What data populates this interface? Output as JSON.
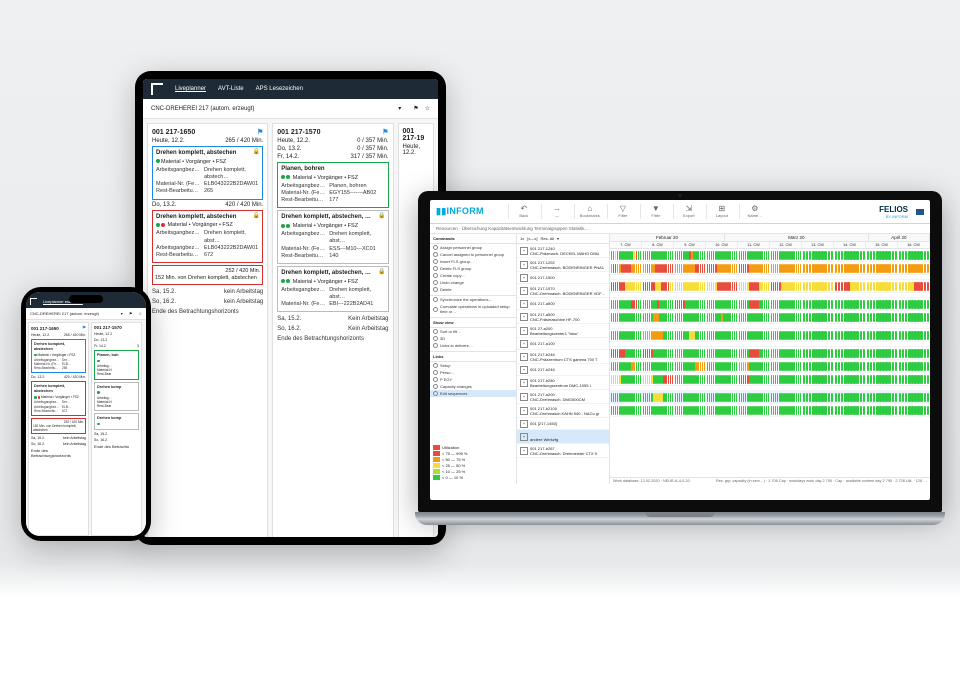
{
  "nav": {
    "liveplanner": "Liveplanner",
    "avt": "AVT-Liste",
    "aps": "APS Lesezeichen"
  },
  "selector": {
    "title": "CNC-DREHEREI 217 (autom. erzeugt)"
  },
  "col1": {
    "id": "001 217-1650",
    "day1": {
      "d": "Heute, 12.2.",
      "m": "265 / 420 Min."
    },
    "card1": {
      "title": "Drehen komplett, abstechen",
      "dots": "gyg",
      "tags": "Material  • Vorgänger  • FSZ",
      "r1k": "Arbeitsgangbez…",
      "r1v": "Drehen komplett, abstech…",
      "r2k": "Material-Nr. (Fe…",
      "r2v": "ELB043222B2DAW01",
      "r3k": "Rest-Bearbeitu…",
      "r3v": "265"
    },
    "day2": {
      "d": "Do, 13.2.",
      "m": "420 / 420 Min."
    },
    "card2": {
      "title": "Drehen komplett, abstechen",
      "dots": "grg",
      "tags": "Material  • Vorgänger  • FSZ",
      "r1k": "Arbeitsgangbez…",
      "r1v": "Drehen komplett, abst…",
      "r2k": "Arbeitsgangbez…",
      "r2v": "ELB043222B2DAW01",
      "r3k": "Rest-Bearbeitu…",
      "r3v": "672"
    },
    "band": "252 / 420 Min.",
    "bandnote": "152 Min. von Drehen komplett, abstechen",
    "s1": {
      "d": "Sa, 15.2.",
      "t": "kein Arbeitstag"
    },
    "s2": {
      "d": "So, 16.2.",
      "t": "kein Arbeitstag"
    },
    "end": "Ende des Betrachtungshorizonts"
  },
  "col2": {
    "id": "001 217-1570",
    "day1": {
      "d": "Heute, 12.2.",
      "m": "0 / 357 Min."
    },
    "day2": {
      "d": "Do, 13.2.",
      "m": "0 / 357 Min."
    },
    "day3": {
      "d": "Fr, 14.2.",
      "m": "317 / 357 Min."
    },
    "card1": {
      "title": "Planen, bohren",
      "dots": "ggg",
      "tags": "Material  • Vorgänger  • FSZ",
      "r1k": "Arbeitsgangbez…",
      "r1v": "Planen, bohren",
      "r2k": "Material-Nr. (Fe…",
      "r2v": "EGY155-------AB02",
      "r3k": "Rest-Bearbeitu…",
      "r3v": "177"
    },
    "card2": {
      "title": "Drehen komplett, abstechen, …",
      "dots": "ggg",
      "tags": "Material  • Vorgänger  • FSZ",
      "r1k": "Arbeitsgangbez…",
      "r1v": "Drehen komplett, abst…",
      "r2k": "Material-Nr. (Fe…",
      "r2v": "ESS---M10---XC01",
      "r3k": "Rest-Bearbeitu…",
      "r3v": "140"
    },
    "card3": {
      "title": "Drehen komplett, abstechen, …",
      "dots": "ggg",
      "tags": "Material  • Vorgänger  • FSZ",
      "r1k": "Arbeitsgangbez…",
      "r1v": "Drehen komplett, abst…",
      "r2k": "Material-Nr. (Fe…",
      "r2v": "EBI---222B2AD41",
      "r3k": "Rest-Bearbeitu…",
      "r3v": ""
    },
    "s1": {
      "d": "Sa, 15.2.",
      "t": "Kein Arbeitstag"
    },
    "s2": {
      "d": "So, 16.2.",
      "t": "Kein Arbeitstag"
    },
    "end": "Ende des Betrachtungshorizonts"
  },
  "col3": {
    "id": "001 217-19",
    "day1": {
      "d": "Heute, 12.2."
    }
  },
  "phone": {
    "nav": "Liveplanner  eszeichen",
    "selector": "CNC-DREHEREI 217 (autom. erzeugt)",
    "c1": {
      "id": "001 217-1650",
      "d1": "Heute, 12.2.",
      "m1": "265 / 420 Min.",
      "d2": "Do, 13.2.",
      "m2": "420 / 420 Min.",
      "band": "252 / 420 Min.",
      "bandnote": "152 Min. von Drehen komplett, abstechen",
      "s1": "Sa, 15.2.",
      "s1t": "kein Arbeitstag",
      "s2": "So, 16.2.",
      "s2t": "kein Arbeitstag",
      "end": "Ende des Betrachtungshorizonts"
    },
    "c2": {
      "id": "001 217-1570",
      "d1": "Heute, 12.2",
      "d3": "Fr, 14.2",
      "m3": "3",
      "pb": "Planen, boh",
      "dk": "Drehen komp",
      "s1": "Sa, 15.2.",
      "s2": "So, 16.2.",
      "end": "Ende des Betrachtu"
    }
  },
  "fl": {
    "brand1": "INFORM",
    "brand2": "FELIOS",
    "brand2sub": "BY INFORM",
    "toolbar": [
      {
        "ic": "↶",
        "lb": "Back"
      },
      {
        "ic": "→",
        "lb": "—"
      },
      {
        "ic": "⌂",
        "lb": "Bookmarks"
      },
      {
        "ic": "▽",
        "lb": "Filter"
      },
      {
        "ic": "▼",
        "lb": "Filter"
      },
      {
        "ic": "⇲",
        "lb": "Export"
      },
      {
        "ic": "⊞",
        "lb": "Layout"
      },
      {
        "ic": "⚙",
        "lb": "Name…"
      }
    ],
    "tabs": "Resourcen · Übersichung Kapazitätsentwicklung Terminalgruppen Statistik…",
    "rl_head": {
      "a": "1x",
      "b": "[x—x]",
      "c": "Res. All"
    },
    "cmd_h": "Commands",
    "cmds": [
      "Assign personnel group",
      "Cancel assigned to personnel group",
      "Insert FLS group…",
      "Delete FLS group",
      "Create copy…",
      "Undo change",
      "Delete"
    ],
    "cmd2": [
      "Synchronize the operations…",
      "Cumulate operations in uploaded setup time or…"
    ],
    "view_h": "Show view",
    "views": [
      "Sort or filt…",
      "3D",
      "Links to delivere…"
    ],
    "link_h": "Links",
    "links": [
      "Setup",
      "Perso…",
      "P EGY",
      "Capacity changes",
      "Edit sequences"
    ],
    "legend": [
      {
        "c": "r",
        "t": "Utilization"
      },
      {
        "c": "r",
        "t": "< 75 — 999 %"
      },
      {
        "c": "o",
        "t": "< 50 — 75 %"
      },
      {
        "c": "y",
        "t": "< 25 — 50 %"
      },
      {
        "c": "lg1",
        "t": "< 10 — 25 %"
      },
      {
        "c": "g",
        "t": "<  0 — 10 %"
      }
    ],
    "resources": [
      {
        "id": "001 217-1240",
        "n": "CNC-Präzmach. DECKEL MAHO DMU"
      },
      {
        "id": "001 217-1292",
        "n": "CNC-Drehmasch. BODENRINGER PNA1"
      },
      {
        "id": "001 217-1500",
        "n": ""
      },
      {
        "id": "001 217-1570",
        "n": "CNC-Drehmasch. BODENRINGER VDF 21"
      },
      {
        "id": "001 217-a500",
        "n": ""
      },
      {
        "id": "001 217-a500",
        "n": "CNC-Fräsmaschine HF-700"
      },
      {
        "id": "001 27-a200",
        "n": "Bearbeitungscenter1 \"blau\""
      },
      {
        "id": "001 217-a100",
        "n": ""
      },
      {
        "id": "001 217-b246",
        "n": "CNC-Präzzentrum CTS gamma 700 T"
      },
      {
        "id": "001 217-b246",
        "n": ""
      },
      {
        "id": "001 217-b280",
        "n": "Bearbeitungszentrum DMC-1055 I"
      },
      {
        "id": "001 217-a200",
        "n": "CNC-Drehmasch. DMG500CM"
      },
      {
        "id": "001 217-b2100",
        "n": "CNC-Drehmasch KAHN 540 - NACo gr"
      },
      {
        "id": "001 [217-1450]",
        "n": ""
      },
      {
        "id": "",
        "n": "andere Werkzfg"
      },
      {
        "id": "001 217-b267",
        "n": "CNC-Drehmasch. Drehmeister CTX 5"
      }
    ],
    "months": [
      {
        "n": "Februar 20",
        "w": 36
      },
      {
        "n": "März 20",
        "w": 45
      },
      {
        "n": "April 20",
        "w": 19
      }
    ],
    "weeks": [
      "7. CW",
      "8. CW",
      "9. CW",
      "10. CW",
      "11. CW",
      "12. CW",
      "13. CW",
      "14. CW",
      "15. CW",
      "16. CW"
    ],
    "rows": [
      "ggygg ggggg gyrgg|ggggg ggggg ggggg|ggggg ggrog ggggg|ggggg ggggg ggggg|ggggg ggggg ggggg|ggggg ggggg ggggg|ggggg ggggg|ggggg ggggg|ggggg ggggg|ggggg ggggg",
      "orroo rrrrr ooooo|ooggo orrrr rrrrr|ooooo ooooo rrrrr|rrrrr ooooo ooooo|rrrrr ooooo ooooo|ooooo ooooo ooooo|ooooo ooooo|ooooo ooooo|ooooo ooooo|ooooo ooooo",
      "",
      "rrrrr rryyy yyyyy|rrrrr ryyyr rrryy|yyyyy yyyyy yyyyy|yyyyy rrrrr rrrrr|yyyyy rrrrr yyyyy|rrrrr yyyyy yyyyy|yyyyy yyyyy|rrrrr yyyyy|yyyyy yyyyy|yyyyy rrrrr",
      "",
      "ggggg ggggg rrrgg|ggggg ggrgg ggggg|rrrrr ggggg ggggg|ggggg ggggg ggggg|ggggg rrrrr ggggg|ggggg ggggg ggggg|ggggg ggggg|ggggg ggggg|ggggg ggggg|ggggg ggggg",
      "ggggg ggggg ggggg|ggggg ooogg ggggg|ggggg ggggg ggggg|ggggg ggogg ggggg|ggggg ggggg ggggg|ggggg ggggg ggggg|ggggg ggggg|ggggg ggggg|ggggg ggggg|ggggg ggggg",
      "",
      "ggggg ggggg ggggg|ooooo ooooo ggggg|ggggg ggyyy ggggg|ggggg ggggg ggggg|ggggg ggggg ggggg|ggggg ggggg ggggg|ggggg ggggg|ggggg ggggg|ggggg ggggg|ggggg ggggg",
      "",
      "rrrrr rrggg ggggg|rrrrr ggggg ggggg|ggggg ggggg ggggg|ggggg ggggg ggggg|ggggg rrrrr ggggg|ggggg ggggg ggggg|ggggg ggggg|ggggg ggggg|ggggg ggggg|ggggg ggggg",
      "ggggg ggggg ooggg|ggggg ggggg ggggg|ggggg ggggg ooooo|ggggg ggggg ggggg|ooooo ggggg ggggg|ggggg ggggg ggggg|ggggg ggggg|ggggg ggggg|ggggg ggggg|ggggg ggggg",
      "yyyyy ggggg ggggg|yyyyy ggggg rrrrr|ggggg ggggg ggggg|ggggg ggggg ggggg|rrrrr ggggg ggggg|ggggg ggggg ggggg|ggggg ggggg|ggggg ggggg|ggggg ggggg|ggggg ggggg",
      "",
      "ggggg ggggg ggggg|ggggg yyyyy ggggg|ggggg ggggg ggggg|ggggg ggggg ggggg|ggggg ggggg ggggg|ggggg ggggg ggggg|ggggg ggggg|ggggg ggggg|ggggg ggggg|ggggg ggggg",
      "ggggg ggggg ggggg|ggggg ggggg ggggg|ggggg ggggg ggggg|ggggg ggggg ggggg|ggggg ggggg ggggg|ggggg ggggg ggggg|ggggg ggggg|ggggg ggggg|ggggg ggggg|ggggg ggggg"
    ],
    "foot": {
      "a": "Work database:  12.02.2020 · NEUR-A-4-0-20",
      "b": "Res. grp: capacity (in serv…) · 1 706   Cap · workdays work day 2 795 · Cap · available content day 2 795 · 2 728   Util. · 128 …"
    }
  }
}
